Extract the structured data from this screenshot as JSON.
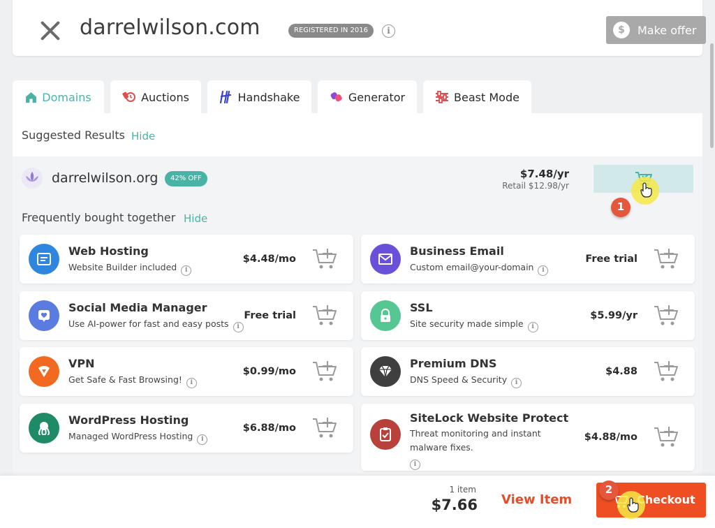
{
  "header": {
    "domain": "darrelwilson.com",
    "registered_badge": "REGISTERED IN 2016",
    "make_offer_label": "Make offer",
    "make_offer_symbol": "$"
  },
  "tabs": [
    {
      "label": "Domains",
      "icon": "home-icon",
      "active": true
    },
    {
      "label": "Auctions",
      "icon": "gavel-icon",
      "active": false
    },
    {
      "label": "Handshake",
      "icon": "handshake-icon",
      "active": false
    },
    {
      "label": "Generator",
      "icon": "generator-icon",
      "active": false
    },
    {
      "label": "Beast Mode",
      "icon": "sliders-icon",
      "active": false
    }
  ],
  "suggested": {
    "heading": "Suggested Results",
    "hide_label": "Hide",
    "domain": "darrelwilson.org",
    "discount_badge": "42% OFF",
    "price": "$7.48/yr",
    "retail": "Retail $12.98/yr"
  },
  "fbt": {
    "heading": "Frequently bought together",
    "hide_label": "Hide"
  },
  "products": [
    {
      "name": "Web Hosting",
      "desc": "Website Builder included",
      "price": "$4.48/mo",
      "icon": "web-hosting-icon",
      "color": "#2f86de"
    },
    {
      "name": "Business Email",
      "desc": "Custom email@your-domain",
      "price": "Free trial",
      "icon": "mail-icon",
      "color": "#6a4fd8"
    },
    {
      "name": "Social Media Manager",
      "desc": "Use AI-power for fast and easy posts",
      "price": "Free trial",
      "icon": "social-heart-icon",
      "color": "#5a7be0"
    },
    {
      "name": "SSL",
      "desc": "Site security made simple",
      "price": "$5.99/yr",
      "icon": "lock-icon",
      "color": "#56c792"
    },
    {
      "name": "VPN",
      "desc": "Get Safe & Fast Browsing!",
      "price": "$0.99/mo",
      "icon": "vpn-icon",
      "color": "#f26a21"
    },
    {
      "name": "Premium DNS",
      "desc": "DNS Speed & Security",
      "price": "$4.88",
      "icon": "diamond-icon",
      "color": "#3f3f3f"
    },
    {
      "name": "WordPress Hosting",
      "desc": "Managed WordPress Hosting",
      "price": "$6.88/mo",
      "icon": "octopus-icon",
      "color": "#1f8a66"
    },
    {
      "name": "SiteLock Website Protect",
      "desc": "Threat monitoring and instant malware fixes.",
      "price": "$4.88/mo",
      "icon": "shield-check-icon",
      "color": "#b8413c"
    }
  ],
  "cart": {
    "count": "1 item",
    "total": "$7.66",
    "view_item": "View Item",
    "checkout": "Checkout"
  },
  "markers": {
    "one": "1",
    "two": "2"
  },
  "colors": {
    "accent": "#4bb3a5",
    "checkout": "#ee4e22",
    "view_item": "#e44d28"
  }
}
